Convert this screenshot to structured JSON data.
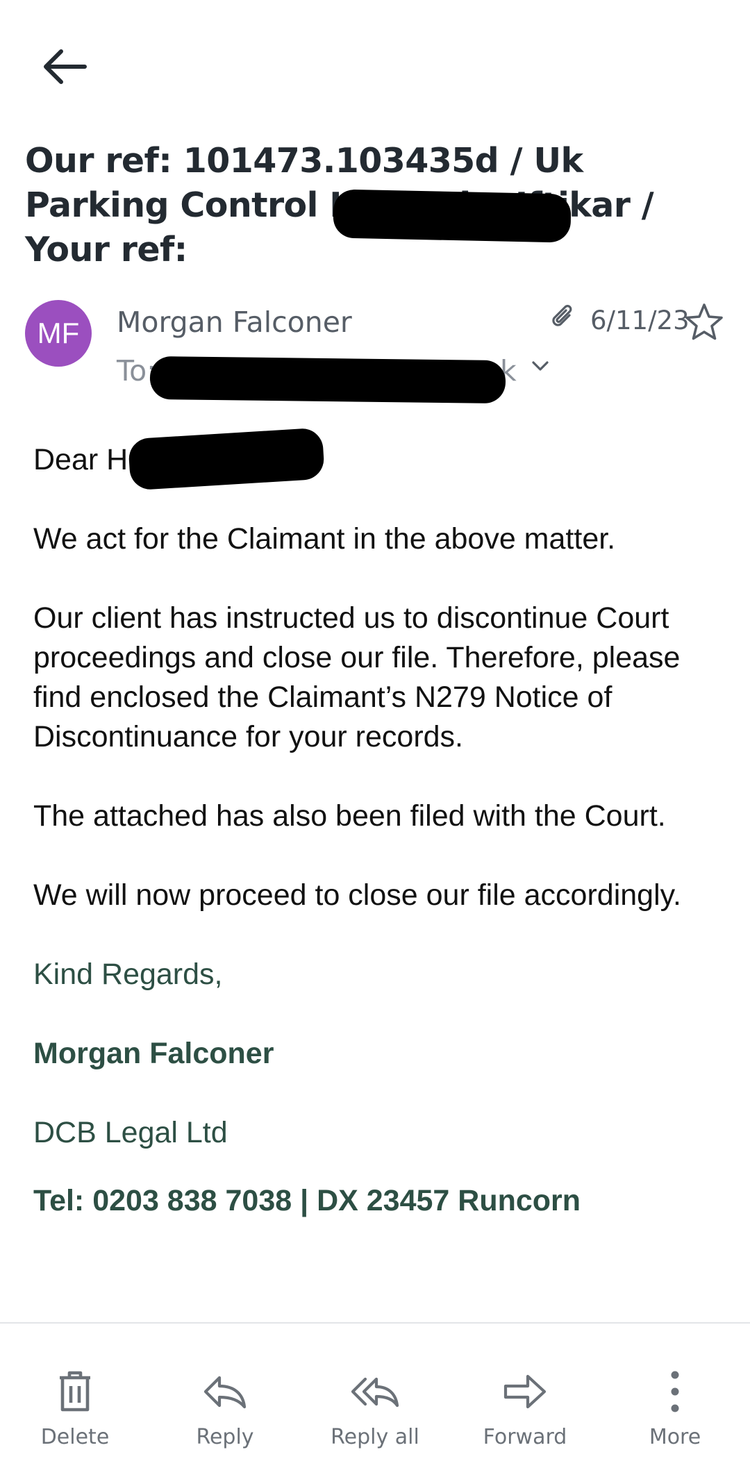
{
  "subject": "Our ref: 101473.103435d / Uk Parking Control Limited v Iftikar / Your ref:",
  "sender": {
    "initials": "MF",
    "name": "Morgan Falconer",
    "date": "6/11/23",
    "to_label": "To:",
    "to_tail": "k",
    "avatar_color": "#9b4fbf"
  },
  "body": {
    "greeting": "Dear Hr,",
    "paragraphs": [
      "We act for the Claimant in the above matter.",
      "Our client has instructed us to discontinue Court proceedings and close our file. Therefore, please find enclosed the Claimant’s N279 Notice of Discontinuance for your records.",
      "The attached has also been filed with the Court.",
      "We will now proceed to close our file accordingly."
    ],
    "sign_off": "Kind Regards,",
    "signature_name": "Morgan Falconer",
    "company": "DCB Legal Ltd",
    "contact": "Tel: 0203 838 7038 | DX 23457 Runcorn"
  },
  "toolbar": {
    "delete_label": "Delete",
    "reply_label": "Reply",
    "reply_all_label": "Reply all",
    "forward_label": "Forward",
    "more_label": "More"
  },
  "colors": {
    "signature": "#2d4f44",
    "subject": "#232a31",
    "icons": "#6b7178"
  },
  "icons": [
    "back-arrow-icon",
    "paperclip-icon",
    "star-icon",
    "chevron-down-icon",
    "trash-icon",
    "reply-icon",
    "reply-all-icon",
    "forward-icon",
    "more-vertical-icon"
  ]
}
